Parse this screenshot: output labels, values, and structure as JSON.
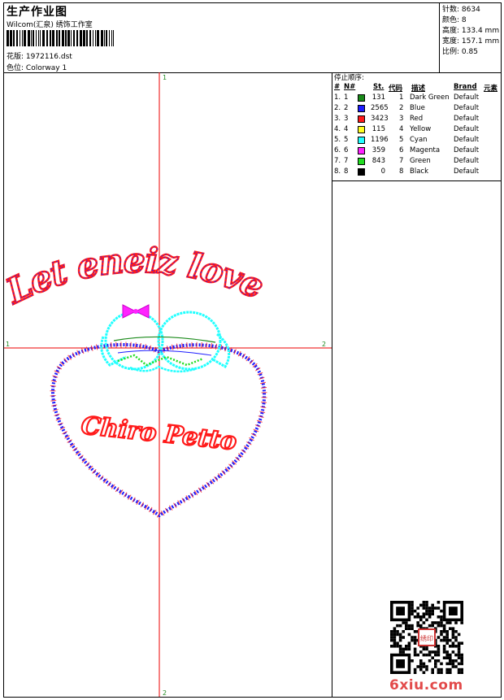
{
  "header": {
    "title": "生产作业图",
    "subtitle": "Wilcom(汇泉) 绣饰工作室",
    "design_label": "花版:",
    "design_value": "1972116.dst",
    "colorway_label": "色位:",
    "colorway_value": "Colorway 1"
  },
  "stats": [
    {
      "label": "针数",
      "value": "8634"
    },
    {
      "label": "颜色",
      "value": "8"
    },
    {
      "label": "高度",
      "value": "133.4 mm"
    },
    {
      "label": "宽度",
      "value": "157.1 mm"
    },
    {
      "label": "比例",
      "value": "0.85"
    }
  ],
  "stop_sequence": {
    "title": "停止顺序:",
    "headers": {
      "num": "#",
      "no": "N#",
      "st": "St.",
      "code": "代码",
      "desc": "描述",
      "brand": "Brand",
      "elem": "元素"
    },
    "rows": [
      {
        "num": "1.",
        "no": "1",
        "color": "#1a8a1a",
        "st": "131",
        "code": "1",
        "desc": "Dark Green",
        "brand": "Default"
      },
      {
        "num": "2.",
        "no": "2",
        "color": "#1c1cff",
        "st": "2565",
        "code": "2",
        "desc": "Blue",
        "brand": "Default"
      },
      {
        "num": "3.",
        "no": "3",
        "color": "#ff1a1a",
        "st": "3423",
        "code": "3",
        "desc": "Red",
        "brand": "Default"
      },
      {
        "num": "4.",
        "no": "4",
        "color": "#ffff22",
        "st": "115",
        "code": "4",
        "desc": "Yellow",
        "brand": "Default"
      },
      {
        "num": "5.",
        "no": "5",
        "color": "#22ffff",
        "st": "1196",
        "code": "5",
        "desc": "Cyan",
        "brand": "Default"
      },
      {
        "num": "6.",
        "no": "6",
        "color": "#ff22ff",
        "st": "359",
        "code": "6",
        "desc": "Magenta",
        "brand": "Default"
      },
      {
        "num": "7.",
        "no": "7",
        "color": "#22dd22",
        "st": "843",
        "code": "7",
        "desc": "Green",
        "brand": "Default"
      },
      {
        "num": "8.",
        "no": "8",
        "color": "#000000",
        "st": "0",
        "code": "8",
        "desc": "Black",
        "brand": "Default"
      }
    ]
  },
  "canvas": {
    "axis_marks": {
      "top": "1",
      "bottom": "2",
      "left": "1",
      "right": "2"
    },
    "arc_text": "Let eneiz love",
    "inner_text": "Chiro Petto"
  },
  "watermark": "6xiu.com",
  "qr_stamp_text": "绣印"
}
